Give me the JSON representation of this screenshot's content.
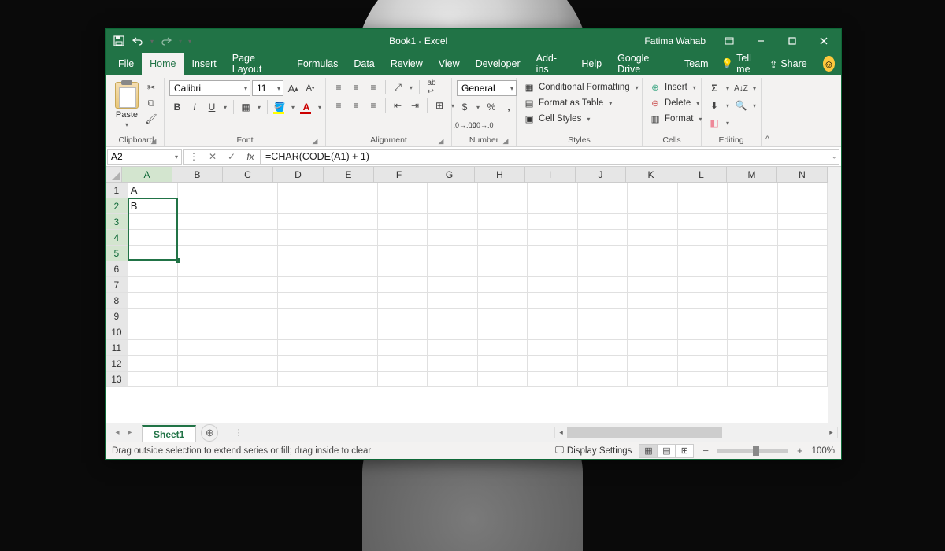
{
  "title": "Book1  -  Excel",
  "user": "Fatima Wahab",
  "menu": [
    "File",
    "Home",
    "Insert",
    "Page Layout",
    "Formulas",
    "Data",
    "Review",
    "View",
    "Developer",
    "Add-ins",
    "Help",
    "Google Drive",
    "Team"
  ],
  "active_menu": "Home",
  "tell_me": "Tell me",
  "share": "Share",
  "ribbon": {
    "clipboard": {
      "label": "Clipboard",
      "paste": "Paste"
    },
    "font": {
      "label": "Font",
      "name": "Calibri",
      "size": "11"
    },
    "alignment": {
      "label": "Alignment"
    },
    "number": {
      "label": "Number",
      "format": "General"
    },
    "styles": {
      "label": "Styles",
      "cond": "Conditional Formatting",
      "table": "Format as Table",
      "cell": "Cell Styles"
    },
    "cells": {
      "label": "Cells",
      "insert": "Insert",
      "delete": "Delete",
      "format": "Format"
    },
    "editing": {
      "label": "Editing"
    }
  },
  "namebox": "A2",
  "formula": "=CHAR(CODE(A1) + 1)",
  "columns": [
    "A",
    "B",
    "C",
    "D",
    "E",
    "F",
    "G",
    "H",
    "I",
    "J",
    "K",
    "L",
    "M",
    "N"
  ],
  "rows": [
    1,
    2,
    3,
    4,
    5,
    6,
    7,
    8,
    9,
    10,
    11,
    12,
    13
  ],
  "cell_data": {
    "A1": "A",
    "A2": "B"
  },
  "selection": {
    "col": "A",
    "rows": [
      2,
      5
    ],
    "active_row": 2
  },
  "sheet": "Sheet1",
  "status": "Drag outside selection to extend series or fill; drag inside to clear",
  "display_settings": "Display Settings",
  "zoom": "100%"
}
